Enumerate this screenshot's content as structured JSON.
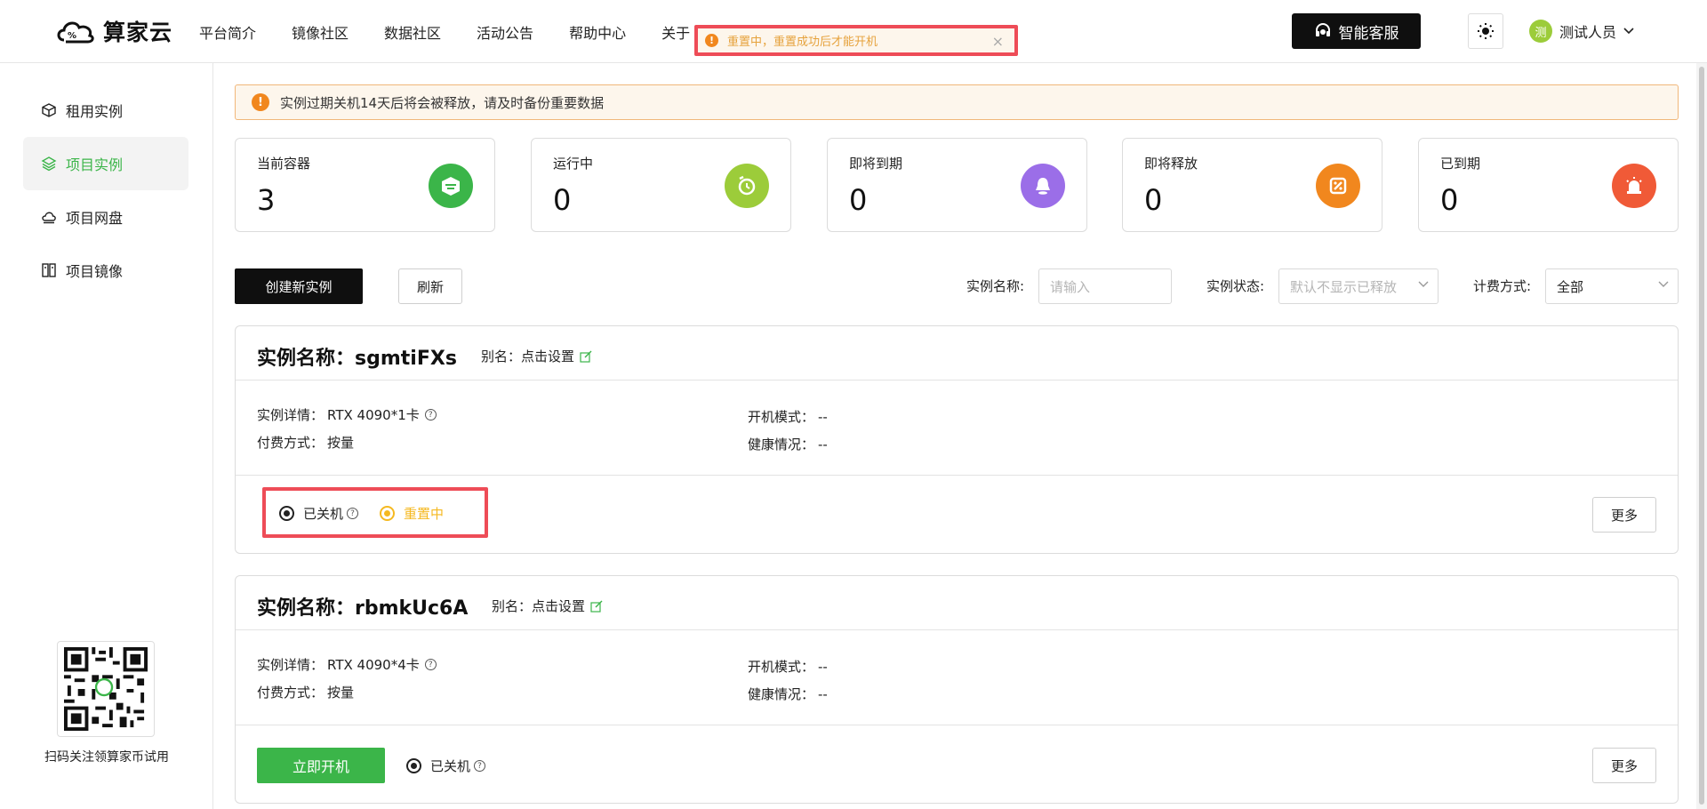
{
  "header": {
    "brand": "算家云",
    "nav": [
      "平台简介",
      "镜像社区",
      "数据社区",
      "活动公告",
      "帮助中心",
      "关于"
    ],
    "toast": "重置中，重置成功后才能开机",
    "support_button": "智能客服",
    "avatar_char": "测",
    "user_name": "测试人员"
  },
  "sidebar": {
    "items": [
      {
        "label": "租用实例",
        "icon": "cube-icon"
      },
      {
        "label": "项目实例",
        "icon": "layers-icon"
      },
      {
        "label": "项目网盘",
        "icon": "cloud-drive-icon"
      },
      {
        "label": "项目镜像",
        "icon": "image-icon"
      }
    ],
    "active_index": 1,
    "qr_caption": "扫码关注领算家币试用"
  },
  "alert": "实例过期关机14天后将会被释放，请及时备份重要数据",
  "stats": [
    {
      "label": "当前容器",
      "value": "3",
      "color": "#3bb549",
      "icon": "container-icon"
    },
    {
      "label": "运行中",
      "value": "0",
      "color": "#9ccc3a",
      "icon": "running-icon"
    },
    {
      "label": "即将到期",
      "value": "0",
      "color": "#9b6ee8",
      "icon": "bell-icon"
    },
    {
      "label": "即将释放",
      "value": "0",
      "color": "#f1871e",
      "icon": "release-icon"
    },
    {
      "label": "已到期",
      "value": "0",
      "color": "#f05a37",
      "icon": "alarm-icon"
    }
  ],
  "toolbar": {
    "create_label": "创建新实例",
    "refresh_label": "刷新",
    "name_label": "实例名称:",
    "name_placeholder": "请输入",
    "status_label": "实例状态:",
    "status_placeholder": "默认不显示已释放",
    "billing_label": "计费方式:",
    "billing_value": "全部"
  },
  "instances": [
    {
      "title": "实例名称：sgmtiFXs",
      "alias": "别名：点击设置",
      "detail_label": "实例详情：",
      "detail_value": "RTX 4090*1卡",
      "pay_label": "付费方式：",
      "pay_value": "按量",
      "mode_label": "开机模式：",
      "mode_value": "--",
      "health_label": "健康情况：",
      "health_value": "--",
      "status": "已关机",
      "sub_status": "重置中",
      "more_label": "更多"
    },
    {
      "title": "实例名称：rbmkUc6A",
      "alias": "别名：点击设置",
      "detail_label": "实例详情：",
      "detail_value": "RTX 4090*4卡",
      "pay_label": "付费方式：",
      "pay_value": "按量",
      "mode_label": "开机模式：",
      "mode_value": "--",
      "health_label": "健康情况：",
      "health_value": "--",
      "start_label": "立即开机",
      "status": "已关机",
      "more_label": "更多"
    }
  ]
}
